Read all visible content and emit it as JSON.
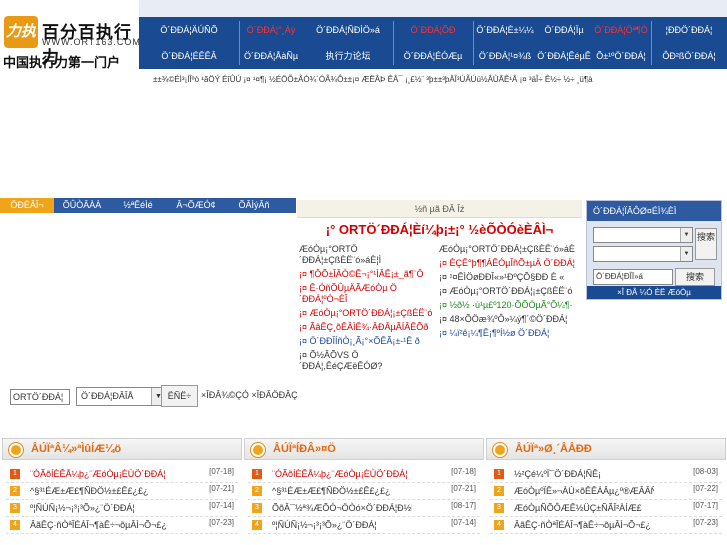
{
  "logo": {
    "badge": "力执",
    "name": "百分百执行力",
    "url": "WWW.ORT163.COM",
    "slogan": "中国执行力第一门户"
  },
  "nav": {
    "row1": [
      {
        "label": "Ö´ÐÐÁ¦ÄÚÑÕ",
        "red": false
      },
      {
        "label": "Ö´ÐÐÁ¦°¸Àý",
        "red": true
      },
      {
        "label": "Ö´ÐÐÁ¦ÑÐÌÖ»á",
        "red": false
      },
      {
        "label": "Ö´ÐÐÁ¦ÕÐ",
        "red": true
      },
      {
        "label": "Ö´ÐÐÁ¦È±¼¼",
        "red": false
      },
      {
        "label": "Ö´ÐÐÁ¦Ïµ",
        "red": false
      },
      {
        "label": "Ö´ÐÐÁ¦Öª¶Ó",
        "red": true
      },
      {
        "label": "¦ÐÐÖ´ÐÐÁ¦",
        "red": false
      }
    ],
    "row2": [
      {
        "label": "Ö´ÐÐÁ¦ÉÊÊÂ"
      },
      {
        "label": "Ö´ÐÐÁ¦ÅàÑµ"
      },
      {
        "label": "执行力论坛"
      },
      {
        "label": "Ö´ÐÐÁ¦ÉÓÆµ"
      },
      {
        "label": "Ö´ÐÐÁ¦¹¤¾ß"
      },
      {
        "label": "Ö´ÐÐÁ¦ÊéµÊ"
      },
      {
        "label": "Õ±¹ºÖ´ÐÐÁ¦"
      },
      {
        "label": "ÔÐ²ßÖ´ÐÐÁ¦"
      }
    ]
  },
  "ticker": "±±¾©ÉÌ³¡ÍÎºò ¹ãÖÝ ÉîÛÚ ¡¤ ¹¤¶¡ ½ÉÖÕ±ÅÓ¾´ÓÃ¾Ô±±¡¤ ÆËÂÞ ÊÂ¯ ¡¸£½¨ ³þ±±³þÂÎ³ÚÃÚú½ÂÙÂÊ¹Â ¡¤ ³äÎ÷ Ê½÷ ½÷ ¸ü¶à",
  "tabs": [
    "ÖÐÈÂÏ¬",
    "ÕÛÒÂÀÀ",
    "½ªÊéÌé",
    "Â¬ÕÆÓ¢",
    "ÕÂÌýÂñ"
  ],
  "search": {
    "value": "ORTÖ´ÐÐÁ¦",
    "select": "Ö´ÐÐÁ¦ÐÂÎÅ",
    "button": "ËÑË÷",
    "advanced": "×ÎÐÂ¾©ÇÓ ×ÎÐÂÖÐÂÇ"
  },
  "center": {
    "header": "½ñ µã ÐÂ Îź",
    "title": "¡° ORTÖ´ÐÐÁ¦Èí¼þ¡±¡° ½èÕÒÓèÈÂÌ¬",
    "left": [
      {
        "text": "ÆóÒµ¡°ORTÖ´ÐÐÁ¦±ÇßÈË¨ó»áÈ¦Ì",
        "style": ""
      },
      {
        "text": "¡¤ ¶ÔÕ±ÎÂÒ©Ê¬¡°¹ÌÂÊ¡±_ã¶¨Ô",
        "style": "red"
      },
      {
        "text": "¡¤ Ê·ÓñÕÛµÄÃÆóÒµ Ö´ÐÐÁ¦ºÓ¬ÈÎ",
        "style": "red"
      },
      {
        "text": "¡¤ ÆóÒµ¡°ORTÖ´ÐÐÁ¦¡±ÇßÈË¨ó",
        "style": "red"
      },
      {
        "text": "¡¤ ÃâÊÇ¸õÊÂÌÊ¾·ÂÐÂµÃÍÂÊÕð",
        "style": "red"
      },
      {
        "text": "¡¤ Ö´ÐÐÎÍñÒ¡¸Ã¡°×ÕÊÃ¡±-¹Ê ð",
        "style": "blue"
      },
      {
        "text": "¡¤ Õ½ÂÕVS Ö´ÐÐÁ¦,ÊéÇÆëÊÓØ?",
        "style": ""
      }
    ],
    "right": [
      {
        "text": "ÆóÒµ¡°ORTÖ´ÐÐÁ¦±ÇßÈË¨ó»áÈ",
        "style": ""
      },
      {
        "text": "¡¤ ÈÇÊ°þ¶¶ÁÊÓµÎñÕ±µÄ Ö´ÐÐÁ¦",
        "style": "red"
      },
      {
        "text": "¡¤ ¹¤ÊÌÖøÐÐÎ«»¹ÐºÇÕ§ÐÐ È «",
        "style": ""
      },
      {
        "text": "¡¤ ÆóÒµ¡°ORTÖ´ÐÐÁ¦¡±ÇßÈË¨ó",
        "style": ""
      },
      {
        "text": "¡¤ ½ð½ ·ú¹µ£º120·ÕÕÒµÃ°Õ¼¶·",
        "style": "green"
      },
      {
        "text": "¡¤ 48×ÕÖæ¾ºÔ»¼ý¶´©Ö´ÐÐÁ¦",
        "style": ""
      },
      {
        "text": "¡¤ ¼ï²ê¡¼¶Ê¡¶ºÍ½ø Ö´ÐÐÁ¦",
        "style": "blue"
      }
    ]
  },
  "login": {
    "header": "Ö´ÐÐÁ¦ÏÂÔØ¤ÉÌ¾ÈÌ",
    "button": "搜索",
    "search_placeholder": "Ö´ÐÐÁ¦ÐÎÏ»á",
    "search_button": "搜索",
    "footer": "×Î ÐÂ ¼Ó ÈË ÆóÒµ"
  },
  "sections": [
    {
      "title": "ÅÚÏªÂ¼»ªÌûÍÆ¼ö",
      "items": [
        {
          "text": "¨ÓÃõÍÈÊÅ¼þ¿¨ÆóÒµ¡ÈÙÖ´ÐÐÁ¦",
          "date": "[07-18]",
          "red": true
        },
        {
          "text": "^§³¹ÉÆ±Æ£¶ÑÐÖ½±£Ê£¿£¿",
          "date": "[07-21]",
          "red": false
        },
        {
          "text": "º¦ÑÚÑ¡½¬¡³¡³Õ»¿¨Ö´ÐÐÁ¦",
          "date": "[07-14]",
          "red": false
        },
        {
          "text": "ÂãÊÇ·ñÒªÎÉÁÎ¬¶àÊ÷¬õµÂÌ¬Õ¬£¿",
          "date": "[07-23]",
          "red": false
        }
      ]
    },
    {
      "title": "ÅÚÏªÍÐÂ»¤Ö",
      "items": [
        {
          "text": "¨ÓÃõÍÈÊÅ¼þ¿¨ÆóÒµ¡ÈÙÖ´ÐÐÁ¦",
          "date": "[07-18]",
          "red": true
        },
        {
          "text": "^§³¹ÉÆ±Æ£¶ÑÐÖ½±£Ê£¿£¿",
          "date": "[07-21]",
          "red": false
        },
        {
          "text": "ÕõÂ¯½ª¾ÆÕÓ¬ÖÒó×Ö´ÐÐÁ¦Ð½ÊÎ",
          "date": "[08-17]",
          "red": false
        },
        {
          "text": "º¦ÑÚÑ¡½¬¡³¡³Õ»¿¨Ö´ÐÐÁ¦",
          "date": "[07-14]",
          "red": false
        }
      ]
    },
    {
      "title": "ÅÚÏª»Ø¸´ÅÅÐÐ",
      "items": [
        {
          "text": "½²Çé¼ºÏ¯Ö´ÐÐÁ¦ÑÊ¡",
          "date": "[08-03]",
          "red": false
        },
        {
          "text": "ÆóÒµºÏÊ»¬ÀÚ×õÊÊÁÂµ¿º®ÆÂÂÑ¡±£",
          "date": "[07-22]",
          "red": false
        },
        {
          "text": "ÆóÒµÑÕÔÆÊ½ÜÇ±ÑÃÎ²ÀÍÆ£",
          "date": "[07-17]",
          "red": false
        },
        {
          "text": "ÂãÊÇ·ñÒªÎÉÁÎ¬¶àÊ÷¬õµÂÌ¬Õ¬£¿",
          "date": "[07-23]",
          "red": false
        }
      ]
    }
  ]
}
